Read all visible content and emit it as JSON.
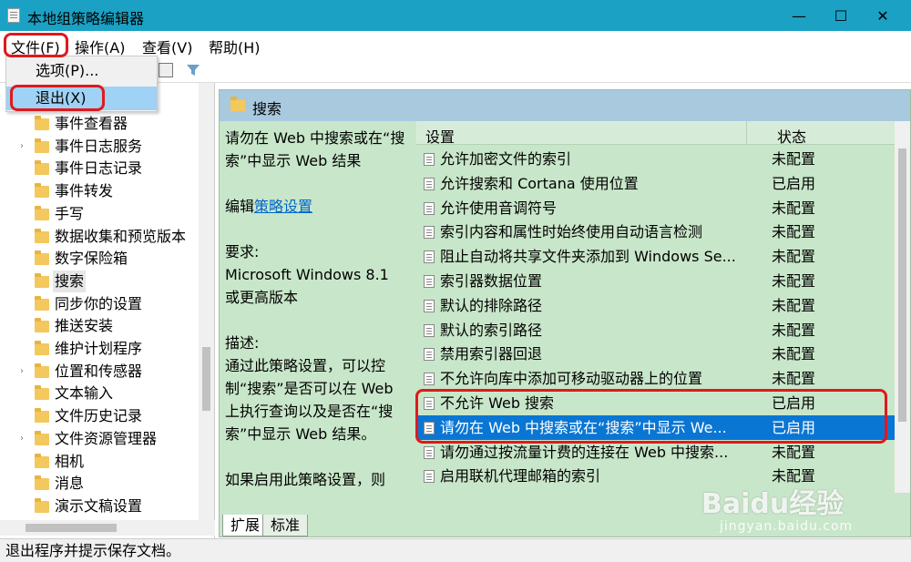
{
  "window": {
    "title": "本地组策略编辑器",
    "minimize": "—",
    "maximize": "☐",
    "close": "✕"
  },
  "menu": {
    "file": "文件(F)",
    "action": "操作(A)",
    "view": "查看(V)",
    "help": "帮助(H)"
  },
  "file_menu": {
    "options": "选项(P)...",
    "exit": "退出(X)"
  },
  "tree": {
    "items": [
      {
        "label": "事件查看器",
        "expandable": false
      },
      {
        "label": "事件日志服务",
        "expandable": true
      },
      {
        "label": "事件日志记录",
        "expandable": false
      },
      {
        "label": "事件转发",
        "expandable": false
      },
      {
        "label": "手写",
        "expandable": false
      },
      {
        "label": "数据收集和预览版本",
        "expandable": false
      },
      {
        "label": "数字保险箱",
        "expandable": false
      },
      {
        "label": "搜索",
        "expandable": false,
        "selected": true
      },
      {
        "label": "同步你的设置",
        "expandable": false
      },
      {
        "label": "推送安装",
        "expandable": false
      },
      {
        "label": "维护计划程序",
        "expandable": false
      },
      {
        "label": "位置和传感器",
        "expandable": true
      },
      {
        "label": "文本输入",
        "expandable": false
      },
      {
        "label": "文件历史记录",
        "expandable": false
      },
      {
        "label": "文件资源管理器",
        "expandable": true
      },
      {
        "label": "相机",
        "expandable": false
      },
      {
        "label": "消息",
        "expandable": false
      },
      {
        "label": "演示文稿设置",
        "expandable": false
      }
    ]
  },
  "right": {
    "header": "搜索",
    "desc": {
      "title": "请勿在 Web 中搜索或在“搜索”中显示 Web 结果",
      "edit_prefix": "编辑",
      "edit_link": "策略设置",
      "requirements_label": "要求:",
      "requirements": "Microsoft Windows 8.1 或更高版本",
      "description_label": "描述:",
      "description": "通过此策略设置，可以控制“搜索”是否可以在 Web 上执行查询以及是否在“搜索”中显示 Web 结果。",
      "more": "如果启用此策略设置，则"
    },
    "columns": {
      "setting": "设置",
      "state": "状态"
    },
    "rows": [
      {
        "name": "允许加密文件的索引",
        "state": "未配置"
      },
      {
        "name": "允许搜索和 Cortana 使用位置",
        "state": "已启用"
      },
      {
        "name": "允许使用音调符号",
        "state": "未配置"
      },
      {
        "name": "索引内容和属性时始终使用自动语言检测",
        "state": "未配置"
      },
      {
        "name": "阻止自动将共享文件夹添加到 Windows Se...",
        "state": "未配置"
      },
      {
        "name": "索引器数据位置",
        "state": "未配置"
      },
      {
        "name": "默认的排除路径",
        "state": "未配置"
      },
      {
        "name": "默认的索引路径",
        "state": "未配置"
      },
      {
        "name": "禁用索引器回退",
        "state": "未配置"
      },
      {
        "name": "不允许向库中添加可移动驱动器上的位置",
        "state": "未配置"
      },
      {
        "name": "不允许 Web 搜索",
        "state": "已启用"
      },
      {
        "name": "请勿在 Web 中搜索或在“搜索”中显示 We...",
        "state": "已启用",
        "selected": true
      },
      {
        "name": "请勿通过按流量计费的连接在 Web 中搜索...",
        "state": "未配置"
      },
      {
        "name": "启用联机代理邮箱的索引",
        "state": "未配置"
      }
    ],
    "tabs": {
      "extended": "扩展",
      "standard": "标准"
    }
  },
  "status": "退出程序并提示保存文档。",
  "watermark": {
    "main": "Baidu经验",
    "sub": "jingyan.baidu.com"
  }
}
